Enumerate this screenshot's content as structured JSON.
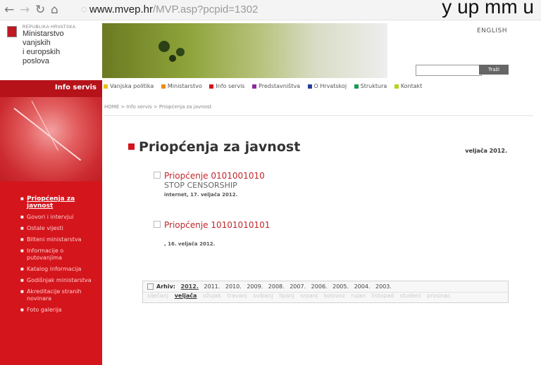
{
  "browser": {
    "back_icon": "arrow-left-icon",
    "forward_icon": "arrow-right-icon",
    "reload_icon": "reload-icon",
    "home_icon": "home-icon",
    "url_host": "www.mvep.hr",
    "url_path": "/MVP.asp?pcpid=1302",
    "overlay_text": "y up mm u"
  },
  "header": {
    "ministry_small": "REPUBLIKA HRVATSKA",
    "ministry_line1": "Ministarstvo",
    "ministry_line2": "vanjskih",
    "ministry_line3": "i europskih",
    "ministry_line4": "poslova",
    "english": "ENGLISH",
    "search_placeholder": "",
    "search_button": "Traži"
  },
  "sidebar": {
    "title": "Info servis",
    "items": [
      {
        "label": "Priopćenja za javnost",
        "active": true
      },
      {
        "label": "Govori i intervjui"
      },
      {
        "label": "Ostale vijesti"
      },
      {
        "label": "Bilteni ministarstva"
      },
      {
        "label": "Informacije o putovanjima"
      },
      {
        "label": "Katalog informacija"
      },
      {
        "label": "Godišnjak ministarstva"
      },
      {
        "label": "Akreditacije stranih novinara"
      },
      {
        "label": "Foto galerija"
      }
    ]
  },
  "topnav": {
    "items": [
      {
        "label": "Vanjska politika",
        "color": "#e8c21a"
      },
      {
        "label": "Ministarstvo",
        "color": "#f08a18"
      },
      {
        "label": "Info servis",
        "color": "#d4151c"
      },
      {
        "label": "Predstavništva",
        "color": "#8b2aa1"
      },
      {
        "label": "O Hrvatskoj",
        "color": "#2a3e9c"
      },
      {
        "label": "Struktura",
        "color": "#1a9a55"
      },
      {
        "label": "Kontakt",
        "color": "#b8d21c"
      }
    ]
  },
  "breadcrumb": "HOME > Info servis > Priopćenja za javnost",
  "main": {
    "title": "Priopćenja za javnost",
    "date": "veljača 2012.",
    "releases": [
      {
        "title": "Priopćenje 0101001010",
        "subtitle": "STOP CENSORSHIP",
        "meta": "internet, 17. veljača 2012."
      },
      {
        "title": "Priopćenje 10101010101",
        "subtitle": "",
        "meta": ", 16. veljača 2012."
      }
    ]
  },
  "archive": {
    "label": "Arhiv:",
    "years": [
      "2012.",
      "2011.",
      "2010.",
      "2009.",
      "2008.",
      "2007.",
      "2006.",
      "2005.",
      "2004.",
      "2003."
    ],
    "current_year": "2012.",
    "months": [
      "siječanj",
      "veljača",
      "ožujak",
      "travanj",
      "svibanj",
      "lipanj",
      "srpanj",
      "kolovoz",
      "rujan",
      "listopad",
      "studeni",
      "prosinac"
    ],
    "current_month": "veljača"
  }
}
